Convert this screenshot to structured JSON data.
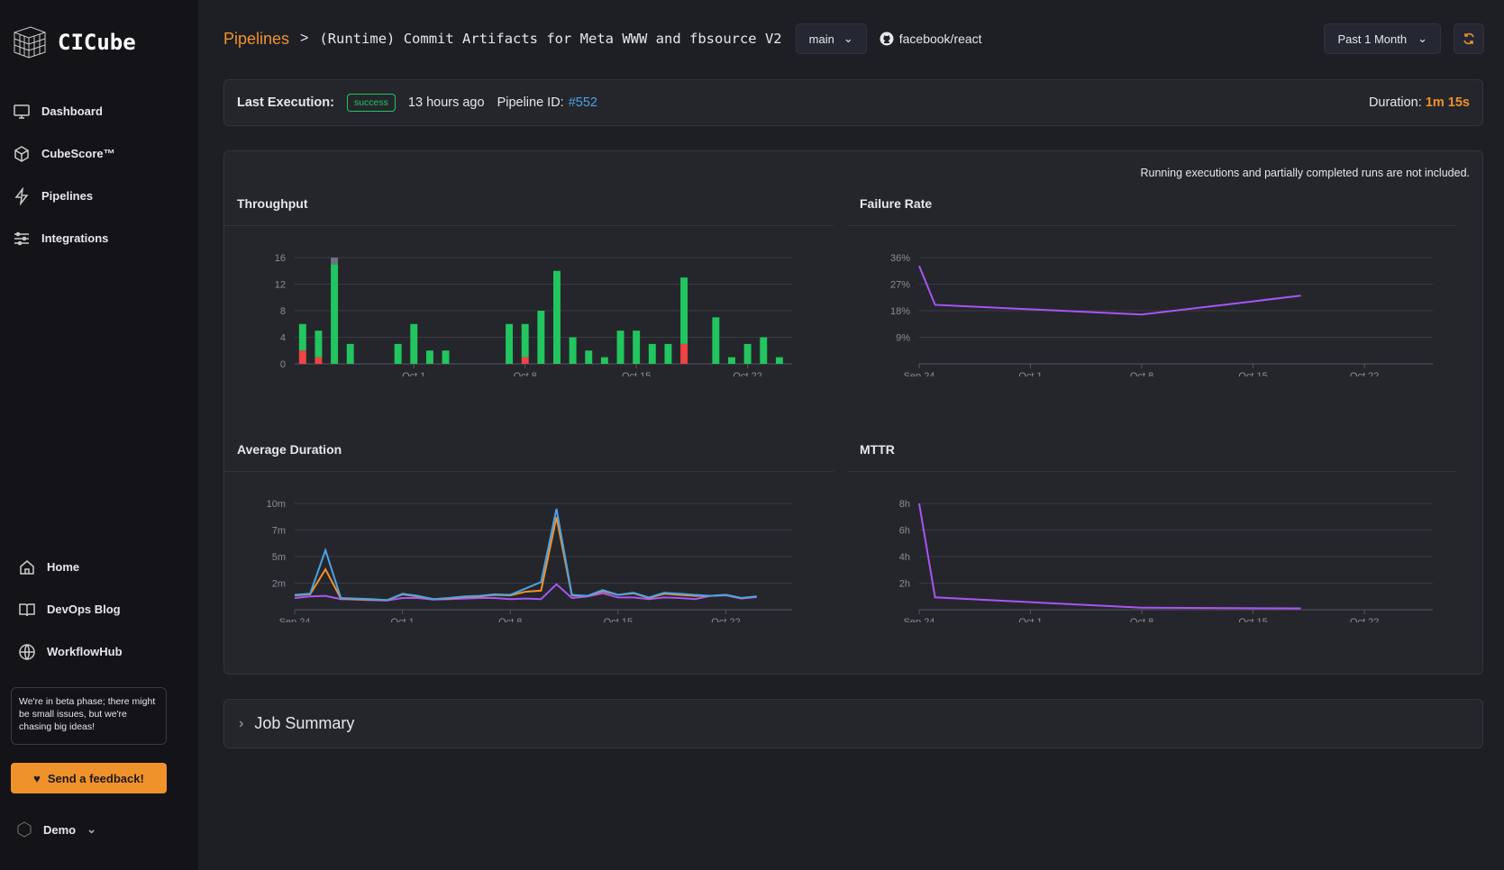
{
  "sidebar": {
    "brand": "CICube",
    "items": [
      {
        "label": "Dashboard",
        "icon": "monitor-icon"
      },
      {
        "label": "CubeScore™",
        "icon": "cube-icon"
      },
      {
        "label": "Pipelines",
        "icon": "lightning-icon"
      },
      {
        "label": "Integrations",
        "icon": "sliders-icon"
      }
    ],
    "links": [
      {
        "label": "Home",
        "icon": "home-icon"
      },
      {
        "label": "DevOps Blog",
        "icon": "book-icon"
      },
      {
        "label": "WorkflowHub",
        "icon": "globe-icon"
      }
    ],
    "beta_notice": "We're in beta phase; there might be small issues, but we're chasing big ideas!",
    "feedback_label": "Send a feedback!",
    "user": "Demo"
  },
  "header": {
    "breadcrumb_link": "Pipelines",
    "separator": ">",
    "title": "(Runtime) Commit Artifacts for Meta WWW and fbsource V2",
    "branch": "main",
    "repo": "facebook/react",
    "range": "Past 1 Month"
  },
  "execution": {
    "label": "Last Execution:",
    "status": "success",
    "time": "13 hours ago",
    "pipeline_id_label": "Pipeline ID:",
    "pipeline_id": "#552",
    "duration_label": "Duration:",
    "duration": "1m 15s"
  },
  "note": "Running executions and partially completed runs are not included.",
  "job_summary": "Job Summary",
  "colors": {
    "accent": "#f0922b",
    "success": "#22c55e",
    "failure": "#ef4444",
    "other": "#6b7280",
    "purple": "#a855f7",
    "blue": "#4ba3e3"
  },
  "chart_data": [
    {
      "type": "bar",
      "title": "Throughput",
      "stacked": true,
      "x": [
        "Sep 24",
        "Sep 25",
        "Sep 26",
        "Sep 27",
        "Sep 28",
        "Sep 29",
        "Sep 30",
        "Oct 1",
        "Oct 2",
        "Oct 3",
        "Oct 4",
        "Oct 5",
        "Oct 6",
        "Oct 7",
        "Oct 8",
        "Oct 9",
        "Oct 10",
        "Oct 11",
        "Oct 12",
        "Oct 13",
        "Oct 14",
        "Oct 15",
        "Oct 16",
        "Oct 17",
        "Oct 18",
        "Oct 19",
        "Oct 20",
        "Oct 21",
        "Oct 22",
        "Oct 23",
        "Oct 24"
      ],
      "series": [
        {
          "color": "#ef4444",
          "values": [
            2,
            1,
            0,
            0,
            0,
            0,
            0,
            0,
            0,
            0,
            0,
            0,
            0,
            0,
            1,
            0,
            0,
            0,
            0,
            0,
            0,
            0,
            0,
            0,
            3,
            0,
            0,
            0,
            0,
            0,
            0
          ]
        },
        {
          "color": "#22c55e",
          "values": [
            4,
            4,
            15,
            3,
            0,
            0,
            3,
            6,
            2,
            2,
            0,
            0,
            0,
            6,
            5,
            8,
            14,
            4,
            2,
            1,
            5,
            5,
            3,
            3,
            10,
            0,
            7,
            1,
            3,
            4,
            1
          ]
        },
        {
          "color": "#6b7280",
          "values": [
            0,
            0,
            1,
            0,
            0,
            0,
            0,
            0,
            0,
            0,
            0,
            0,
            0,
            0,
            0,
            0,
            0,
            0,
            0,
            0,
            0,
            0,
            0,
            0,
            0,
            0,
            0,
            0,
            0,
            0,
            0
          ]
        }
      ],
      "yticks": [
        "0",
        "4",
        "8",
        "12",
        "16"
      ],
      "ylim": [
        0,
        16
      ],
      "xticks": [
        "Oct 1",
        "Oct 8",
        "Oct 15",
        "Oct 22"
      ],
      "grid": true
    },
    {
      "type": "line",
      "title": "Failure Rate",
      "x": [
        "Sep 24",
        "Sep 25",
        "Oct 8",
        "Oct 18"
      ],
      "series": [
        {
          "color": "#a855f7",
          "values": [
            33.2,
            20,
            16.7,
            23.1
          ]
        }
      ],
      "yticks": [
        "9%",
        "18%",
        "27%",
        "36%"
      ],
      "ylim": [
        0,
        36
      ],
      "xticks": [
        "Sep 24",
        "Oct 1",
        "Oct 8",
        "Oct 15",
        "Oct 22"
      ],
      "grid": true
    },
    {
      "type": "line",
      "title": "Average Duration",
      "x": [
        "Sep 24",
        "Sep 25",
        "Sep 26",
        "Sep 27",
        "Sep 28",
        "Sep 29",
        "Sep 30",
        "Oct 1",
        "Oct 2",
        "Oct 3",
        "Oct 4",
        "Oct 5",
        "Oct 6",
        "Oct 7",
        "Oct 8",
        "Oct 9",
        "Oct 10",
        "Oct 11",
        "Oct 12",
        "Oct 13",
        "Oct 14",
        "Oct 15",
        "Oct 16",
        "Oct 17",
        "Oct 18",
        "Oct 19",
        "Oct 20",
        "Oct 21",
        "Oct 22",
        "Oct 23",
        "Oct 24"
      ],
      "series": [
        {
          "color": "#a855f7",
          "values": [
            1.1,
            1.25,
            1.3,
            1.0,
            0.95,
            0.9,
            0.87,
            1.1,
            1.1,
            0.95,
            1.0,
            1.05,
            1.1,
            1.1,
            1.0,
            1.05,
            1.0,
            2.4,
            1.1,
            1.25,
            1.55,
            1.15,
            1.15,
            1.0,
            1.15,
            1.1,
            1.0,
            1.3,
            1.35,
            1.05,
            1.2
          ]
        },
        {
          "color": "#f0922b",
          "values": [
            1.35,
            1.45,
            3.8,
            1.05,
            1.0,
            0.95,
            0.9,
            1.45,
            1.25,
            1.0,
            1.05,
            1.2,
            1.25,
            1.4,
            1.35,
            1.7,
            1.8,
            8.7,
            1.35,
            1.3,
            1.75,
            1.4,
            1.55,
            1.1,
            1.5,
            1.4,
            1.3,
            1.3,
            1.4,
            1.1,
            1.25
          ]
        },
        {
          "color": "#4ba3e3",
          "values": [
            1.4,
            1.5,
            5.6,
            1.1,
            1.05,
            1.0,
            0.9,
            1.5,
            1.3,
            1.0,
            1.1,
            1.25,
            1.3,
            1.45,
            1.4,
            2.0,
            2.6,
            9.5,
            1.4,
            1.3,
            1.85,
            1.4,
            1.6,
            1.15,
            1.6,
            1.5,
            1.4,
            1.3,
            1.4,
            1.1,
            1.25
          ]
        }
      ],
      "yticks": [
        "2m",
        "5m",
        "7m",
        "10m"
      ],
      "ylim": [
        0,
        10
      ],
      "xticks": [
        "Sep 24",
        "Oct 1",
        "Oct 8",
        "Oct 15",
        "Oct 22"
      ],
      "grid": true
    },
    {
      "type": "line",
      "title": "MTTR",
      "x": [
        "Sep 24",
        "Sep 25",
        "Oct 8",
        "Oct 18"
      ],
      "series": [
        {
          "color": "#a855f7",
          "values": [
            8,
            0.93,
            0.15,
            0.1
          ]
        }
      ],
      "yticks": [
        "2h",
        "4h",
        "6h",
        "8h"
      ],
      "ylim": [
        0,
        8
      ],
      "xticks": [
        "Sep 24",
        "Oct 1",
        "Oct 8",
        "Oct 15",
        "Oct 22"
      ],
      "grid": true
    }
  ]
}
